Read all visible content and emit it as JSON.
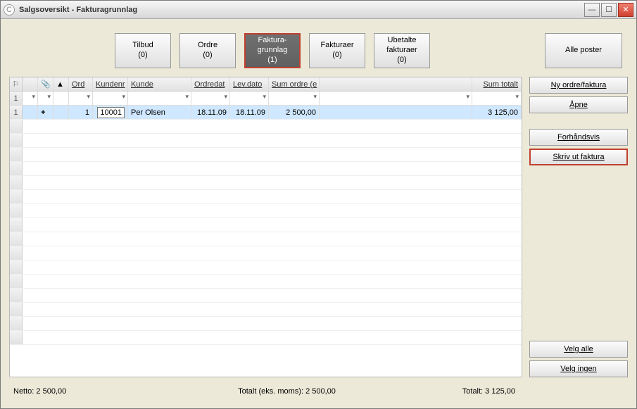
{
  "window": {
    "title": "Salgsoversikt - Fakturagrunnlag"
  },
  "tabs": {
    "tilbud": {
      "label": "Tilbud",
      "count": "(0)"
    },
    "ordre": {
      "label": "Ordre",
      "count": "(0)"
    },
    "grunnlag": {
      "line1": "Faktura-",
      "line2": "grunnlag",
      "count": "(1)"
    },
    "fakturaer": {
      "label": "Fakturaer",
      "count": "(0)"
    },
    "ubetalte": {
      "line1": "Ubetalte",
      "line2": "fakturaer",
      "count": "(0)"
    },
    "alle": {
      "label": "Alle poster"
    }
  },
  "grid": {
    "headers": {
      "ord": "Ord",
      "kundenr": "Kundenr",
      "kunde": "Kunde",
      "ordredat": "Ordredat",
      "levdato": "Lev.dato",
      "sumordre": "Sum ordre (e",
      "sumtotal": "Sum totalt"
    },
    "filter_rownum": "1",
    "row": {
      "rownum": "1",
      "expand": "+",
      "ord": "1",
      "kundenr": "10001",
      "kunde": "Per Olsen",
      "ordredat": "18.11.09",
      "levdato": "18.11.09",
      "sumordre": "2 500,00",
      "sumtotal": "3 125,00"
    }
  },
  "side": {
    "ny": "Ny ordre/faktura",
    "apne": "Åpne",
    "forhandsvis": "Forhåndsvis",
    "skrivut": "Skriv ut faktura",
    "velgalle": "Velg alle",
    "velgingen": "Velg ingen"
  },
  "footer": {
    "netto": "Netto: 2 500,00",
    "totalt_eks": "Totalt (eks. moms): 2 500,00",
    "totalt": "Totalt: 3 125,00"
  }
}
